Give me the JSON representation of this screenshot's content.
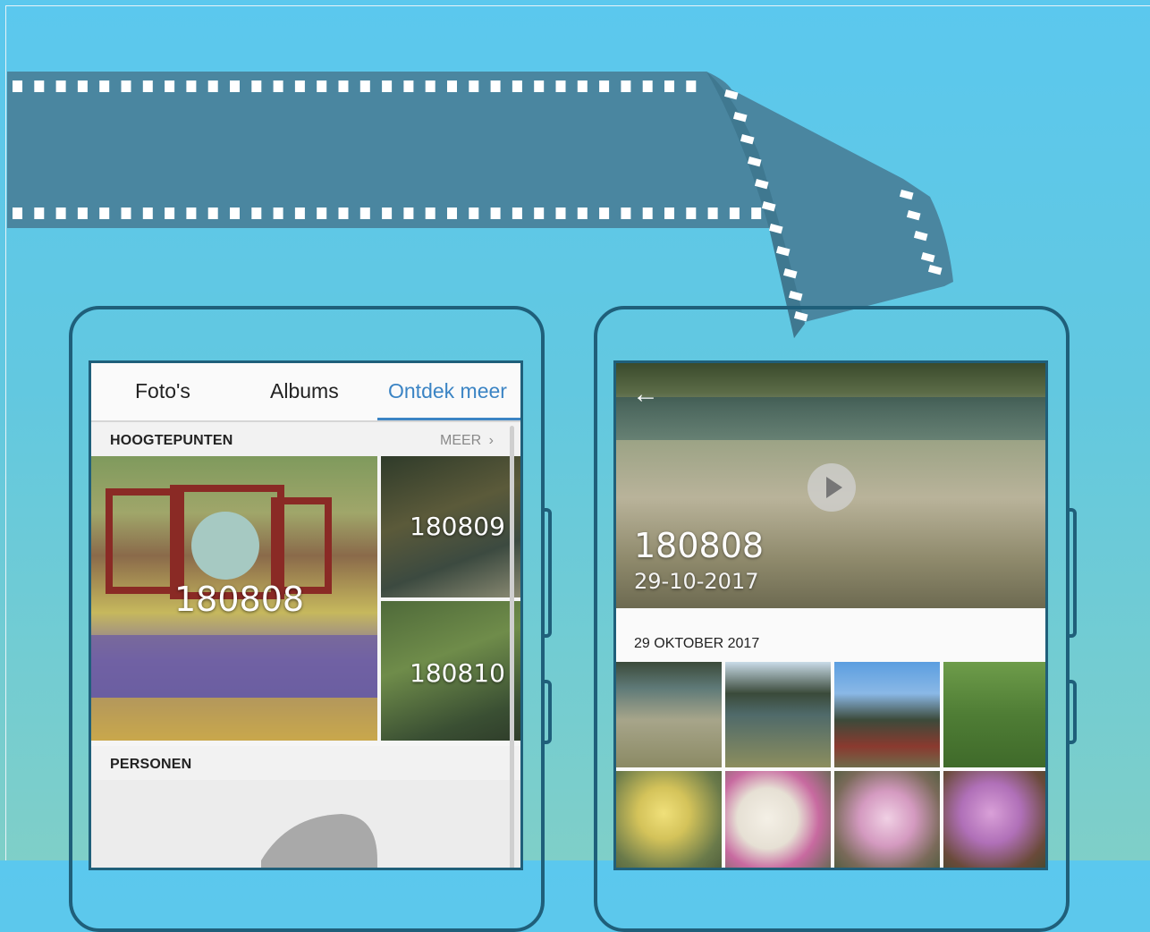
{
  "colors": {
    "background_top": "#5bc8ee",
    "background_bottom": "#7fcfc8",
    "film": "#4a86a0",
    "phone_outline": "#1f5f7a",
    "accent": "#3b84c4"
  },
  "left_phone": {
    "tabs": [
      {
        "label": "Foto's",
        "active": false
      },
      {
        "label": "Albums",
        "active": false
      },
      {
        "label": "Ontdek meer",
        "active": true
      }
    ],
    "highlights": {
      "title": "HOOGTEPUNTEN",
      "more_label": "MEER",
      "more_icon": "chevron-right-icon",
      "items": [
        {
          "label": "180808"
        },
        {
          "label": "180809"
        },
        {
          "label": "180810"
        }
      ]
    },
    "people": {
      "title": "PERSONEN",
      "icon": "person-silhouette-icon"
    }
  },
  "right_phone": {
    "back_icon": "arrow-left-icon",
    "play_icon": "play-icon",
    "album_title": "180808",
    "album_date": "29-10-2017",
    "section_date": "29 OKTOBER 2017",
    "thumbnails": [
      "lake-reeds",
      "lake-trees",
      "pagoda",
      "cypress",
      "yellow-chrysanthemum",
      "white-chrysanthemums",
      "pink-chrysanthemum",
      "purple-chrysanthemum"
    ]
  }
}
